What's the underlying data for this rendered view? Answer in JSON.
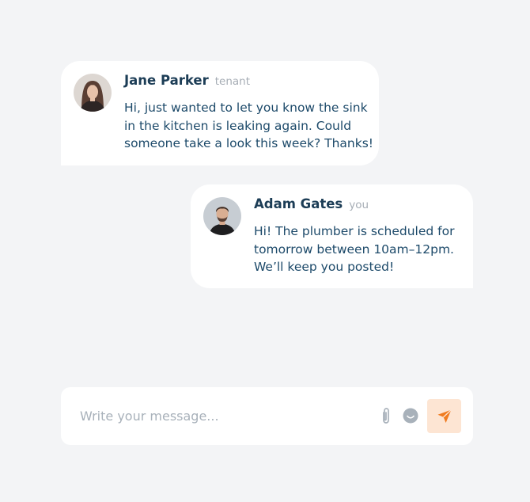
{
  "messages": [
    {
      "sender": "Jane Parker",
      "role": "tenant",
      "lines": [
        "Hi, just wanted to let you know the sink",
        "in the kitchen is leaking again. Could",
        "someone take a look this week? Thanks!"
      ]
    },
    {
      "sender": "Adam Gates",
      "role": "you",
      "lines": [
        "Hi! The plumber is scheduled for",
        "tomorrow between 10am–12pm.",
        "We’ll keep you posted!"
      ]
    }
  ],
  "composer": {
    "placeholder": "Write your message...",
    "value": "",
    "attach_icon": "paperclip-icon",
    "emoji_icon": "smiley-icon",
    "send_icon": "send-icon"
  },
  "colors": {
    "background": "#f3f4f6",
    "bubble": "#ffffff",
    "name_text": "#1c3d56",
    "message_text": "#1d4a6a",
    "muted_text": "#a6adb5",
    "send_button_bg": "#fde5d3",
    "send_icon": "#f07b1f"
  }
}
